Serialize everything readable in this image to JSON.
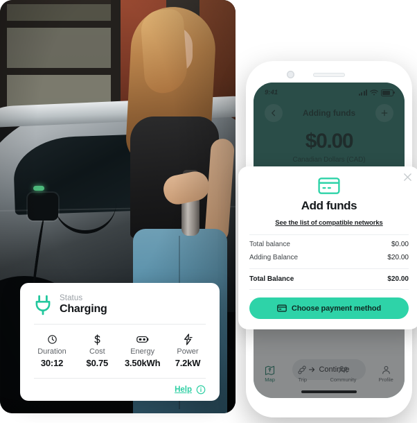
{
  "colors": {
    "brand_teal": "#2c7468",
    "accent_mint": "#2ed3a8",
    "card_white": "#ffffff",
    "muted_text": "#9aa0a6"
  },
  "status_card": {
    "status_label": "Status",
    "status_value": "Charging",
    "plug_icon": "plug-icon",
    "metrics": [
      {
        "icon": "clock-icon",
        "label": "Duration",
        "value": "30:12"
      },
      {
        "icon": "dollar-icon",
        "label": "Cost",
        "value": "$0.75"
      },
      {
        "icon": "battery-icon",
        "label": "Energy",
        "value": "3.50kWh"
      },
      {
        "icon": "lightning-icon",
        "label": "Power",
        "value": "7.2kW"
      }
    ],
    "help_label": "Help",
    "info_icon": "info-circle-icon"
  },
  "phone": {
    "status_bar": {
      "time": "9:41",
      "signal_icon": "cellular-signal-icon",
      "wifi_icon": "wifi-icon",
      "battery_icon": "battery-full-icon"
    },
    "header": {
      "back_icon": "arrow-left-icon",
      "title": "Adding funds",
      "add_icon": "plus-icon",
      "amount": "$0.00",
      "currency": "Canadian Dollars (CAD)"
    },
    "continue_button": {
      "label": "Continue",
      "icon": "arrow-right-icon"
    },
    "tabbar": [
      {
        "icon": "map-icon",
        "label": "Map",
        "active": true
      },
      {
        "icon": "trip-icon",
        "label": "Trip",
        "active": false
      },
      {
        "icon": "community-icon",
        "label": "Community",
        "active": false
      },
      {
        "icon": "profile-icon",
        "label": "Profile",
        "active": false
      }
    ]
  },
  "modal": {
    "close_icon": "close-icon",
    "card_icon": "credit-card-icon",
    "title": "Add funds",
    "networks_link": "See the list of compatible networks",
    "rows": [
      {
        "label": "Total balance",
        "amount": "$0.00"
      },
      {
        "label": "Adding Balance",
        "amount": "$20.00"
      }
    ],
    "total_row": {
      "label": "Total Balance",
      "amount": "$20.00"
    },
    "pay_button": {
      "label": "Choose payment method",
      "icon": "credit-card-small-icon"
    }
  }
}
